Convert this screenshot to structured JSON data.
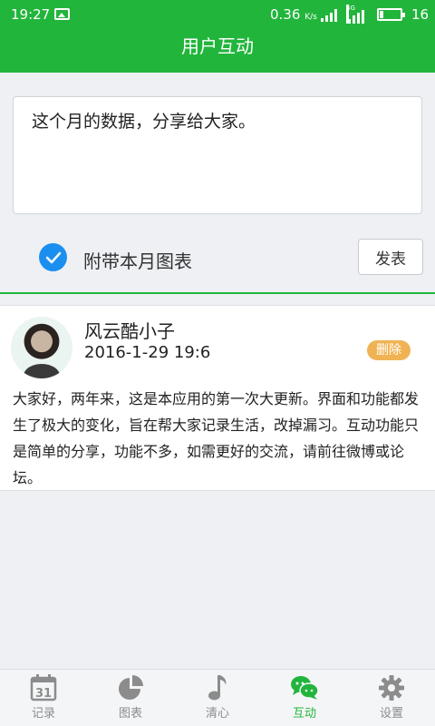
{
  "status_bar": {
    "time": "19:27",
    "speed": "0.36",
    "speed_unit": "K/s",
    "network": "4G",
    "battery": "16"
  },
  "title": "用户互动",
  "composer": {
    "text": "这个月的数据，分享给大家。",
    "attach_label": "附带本月图表",
    "attach_checked": true,
    "publish_label": "发表"
  },
  "post": {
    "username": "风云酷小子",
    "time": "2016-1-29  19:6",
    "delete_label": "删除",
    "content": "大家好，两年来，这是本应用的第一次大更新。界面和功能都发生了极大的变化，旨在帮大家记录生活，改掉漏习。互动功能只是简单的分享，功能不多，如需更好的交流，请前往微博或论坛。"
  },
  "nav": {
    "items": [
      {
        "label": "记录",
        "icon": "calendar-icon"
      },
      {
        "label": "图表",
        "icon": "pie-chart-icon"
      },
      {
        "label": "清心",
        "icon": "music-note-icon"
      },
      {
        "label": "互动",
        "icon": "chat-bubbles-icon",
        "active": true
      },
      {
        "label": "设置",
        "icon": "gear-icon"
      }
    ],
    "calendar_number": "31"
  },
  "colors": {
    "primary": "#22b53c",
    "checkbox": "#1b8ff0",
    "delete_badge": "#f0b354",
    "inactive_icon": "#8c8c8c"
  }
}
